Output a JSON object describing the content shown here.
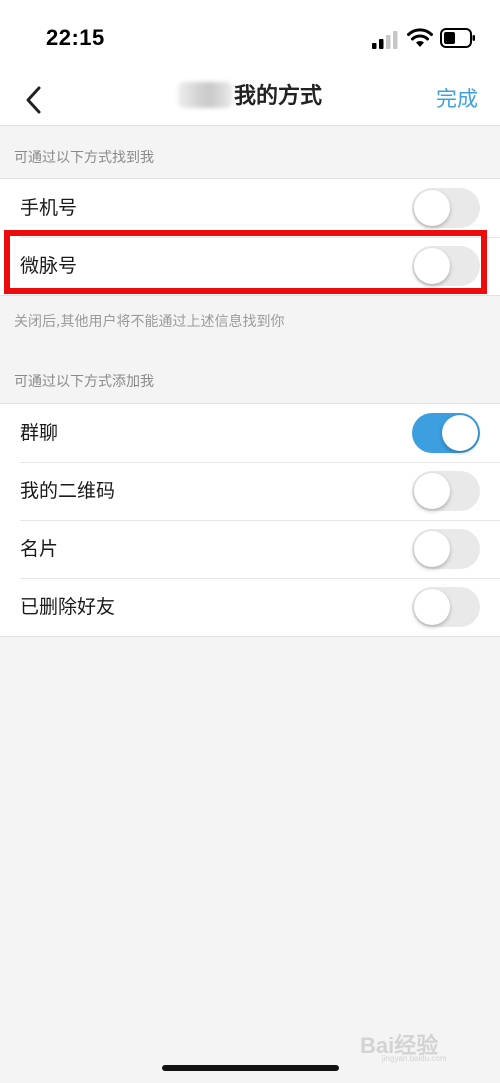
{
  "status_bar": {
    "time": "22:15"
  },
  "nav": {
    "title": "我的方式",
    "done_label": "完成"
  },
  "sections": [
    {
      "header": "可通过以下方式找到我",
      "items": [
        {
          "label": "手机号",
          "on": false
        },
        {
          "label": "微脉号",
          "on": false
        }
      ],
      "footer": "关闭后,其他用户将不能通过上述信息找到你"
    },
    {
      "header": "可通过以下方式添加我",
      "items": [
        {
          "label": "群聊",
          "on": true
        },
        {
          "label": "我的二维码",
          "on": false
        },
        {
          "label": "名片",
          "on": false
        },
        {
          "label": "已删除好友",
          "on": false
        }
      ]
    }
  ],
  "watermark": {
    "text": "Bai经验",
    "sub": "jingyan.baidu.com"
  },
  "colors": {
    "accent": "#3d9ee0",
    "highlight": "#ee0b0b",
    "toggle_off": "#e9e9e9"
  }
}
